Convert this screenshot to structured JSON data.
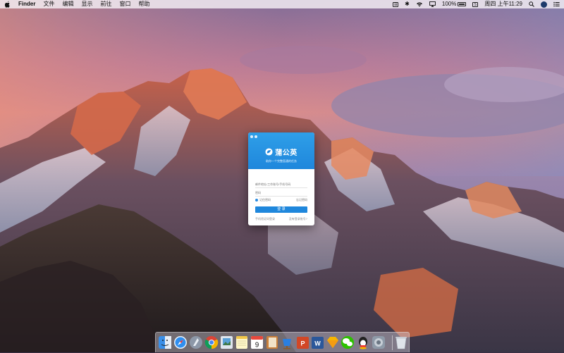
{
  "menubar": {
    "app": "Finder",
    "menus": [
      "文件",
      "编辑",
      "显示",
      "前往",
      "窗口",
      "帮助"
    ],
    "battery": "100%",
    "clock": "周四 上午11:29"
  },
  "login": {
    "brand": "蒲公英",
    "tagline": "助你一个完整直通的任务",
    "username_placeholder": "邮件地址/工作账号/手机号码",
    "password_placeholder": "密码",
    "remember_label": "记住密码",
    "forgot_label": "忘记密码",
    "login_button": "登 录",
    "sms_login": "手机验证码登录",
    "no_account": "没有登录账号?"
  },
  "dock": {
    "calendar_day": "9",
    "items": [
      "finder-icon",
      "safari-icon",
      "launchpad-icon",
      "chrome-icon",
      "preview-icon",
      "notes-icon",
      "calendar-icon",
      "books-icon",
      "keynote-icon",
      "powerpoint-icon",
      "word-icon",
      "sketch-icon",
      "wechat-icon",
      "qq-icon",
      "system-preferences-icon",
      "trash-icon"
    ]
  },
  "colors": {
    "accent": "#1f87dc",
    "menubar_bg": "#f5f0f5"
  }
}
